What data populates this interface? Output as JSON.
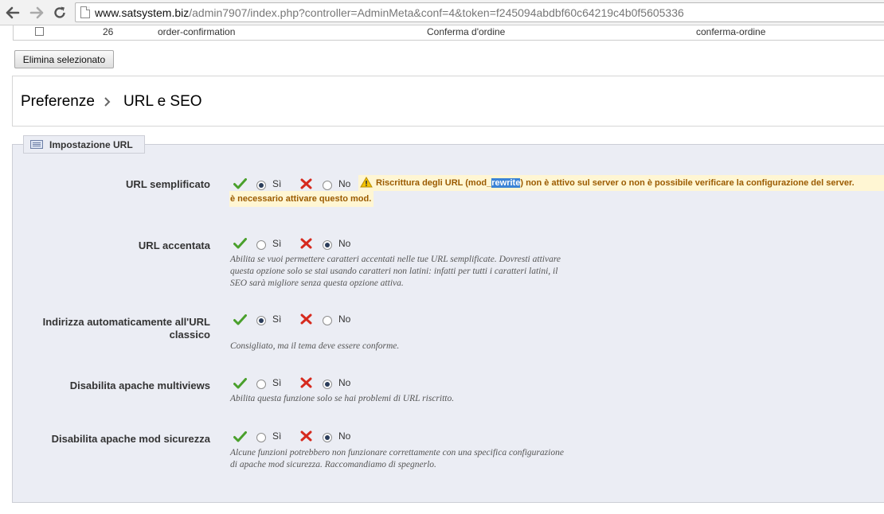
{
  "browser": {
    "url_domain": "www.satsystem.biz",
    "url_rest": "/admin7907/index.php?controller=AdminMeta&conf=4&token=f245094abdbf60c64219c4b0f5605336"
  },
  "table_row": {
    "id": "26",
    "page": "order-confirmation",
    "title": "Conferma d'ordine",
    "rewrite": "conferma-ordine"
  },
  "toolbar": {
    "delete_selected": "Elimina selezionato"
  },
  "breadcrumb": {
    "parent": "Preferenze",
    "current": "URL e SEO"
  },
  "fieldset": {
    "legend": "Impostazione URL",
    "yes_label": "Sì",
    "no_label": "No",
    "warning": {
      "before": "Riscrittura degli URL (mod_",
      "highlighted": "rewrite",
      "after": ") non è attivo sul server o non è possibile verificare la configurazione del server.",
      "line2": "è necessario attivare questo mod."
    },
    "options": [
      {
        "label": "URL semplificato",
        "selected": "yes",
        "hint": []
      },
      {
        "label": "URL accentata",
        "selected": "no",
        "hint": [
          "Abilita se vuoi permettere caratteri accentati nelle tue URL semplificate. Dovresti attivare",
          "questa opzione solo se stai usando caratteri non latini: infatti per tutti i caratteri latini, il",
          "SEO sarà migliore senza questa opzione attiva."
        ]
      },
      {
        "label_line1": "Indirizza automaticamente all'URL",
        "label_line2": "classico",
        "selected": "yes",
        "hint": [
          "Consigliato, ma il tema deve essere conforme."
        ]
      },
      {
        "label": "Disabilita apache multiviews",
        "selected": "no",
        "hint": [
          "Abilita questa funzione solo se hai problemi di URL riscritto."
        ]
      },
      {
        "label": "Disabilita apache mod sicurezza",
        "selected": "no",
        "hint": [
          "Alcune funzioni potrebbero non funzionare correttamente con una specifica configurazione",
          "di apache mod sicurezza. Raccomandiamo di spegnerlo."
        ]
      }
    ]
  },
  "icons": {
    "yes": "check-icon",
    "no": "cross-icon",
    "warning": "warning-icon",
    "back": "back-arrow-icon",
    "forward": "forward-arrow-icon",
    "reload": "reload-icon"
  },
  "colors": {
    "yes_green": "#4aa02c",
    "no_red": "#d62a1e",
    "warning_bg": "#fff6d3",
    "warning_text": "#9b5b00",
    "fieldset_bg": "#ebedf4"
  }
}
